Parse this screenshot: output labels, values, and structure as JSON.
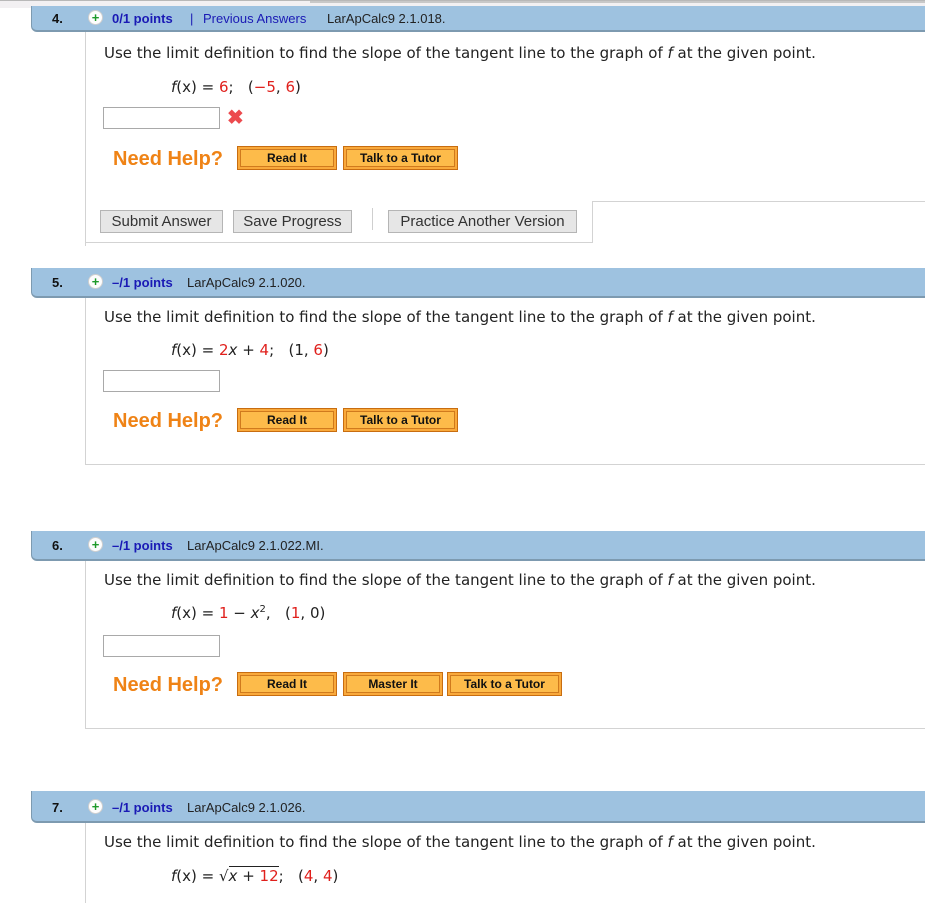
{
  "questions": [
    {
      "number": "4.",
      "points": "0/1 points",
      "separator": "|",
      "previous_answers": "Previous Answers",
      "code": "LarApCalc9 2.1.018.",
      "prompt_pre": "Use the limit definition to find the slope of the tangent line to the graph of ",
      "prompt_var": "f",
      "prompt_post": " at the given point.",
      "formula": {
        "fname": "f",
        "arg": "(x)",
        "eq": " = ",
        "expr_red": "6",
        "expr_tail": ";",
        "point_open": "(",
        "point_x": "−5",
        "point_comma": ", ",
        "point_y": "6",
        "point_close": ")"
      },
      "answer_value": "",
      "status": "incorrect",
      "help_label": "Need Help?",
      "help_buttons": [
        "Read It",
        "Talk to a Tutor"
      ],
      "actions": {
        "submit": "Submit Answer",
        "save": "Save Progress",
        "practice": "Practice Another Version"
      }
    },
    {
      "number": "5.",
      "points": "–/1 points",
      "code": "LarApCalc9 2.1.020.",
      "prompt_pre": "Use the limit definition to find the slope of the tangent line to the graph of ",
      "prompt_var": "f",
      "prompt_post": " at the given point.",
      "formula": {
        "fname": "f",
        "arg": "(x)",
        "eq": " = ",
        "a": "2",
        "x": "x",
        "plus": " + ",
        "b": "4",
        "tail": ";",
        "point_open": "(",
        "point_x": "1",
        "point_comma": ", ",
        "point_y": "6",
        "point_close": ")"
      },
      "answer_value": "",
      "help_label": "Need Help?",
      "help_buttons": [
        "Read It",
        "Talk to a Tutor"
      ]
    },
    {
      "number": "6.",
      "points": "–/1 points",
      "code": "LarApCalc9 2.1.022.MI.",
      "prompt_pre": "Use the limit definition to find the slope of the tangent line to the graph of ",
      "prompt_var": "f",
      "prompt_post": " at the given point.",
      "formula": {
        "fname": "f",
        "arg": "(x)",
        "eq": " = ",
        "a": "1",
        "minus": " − ",
        "x": "x",
        "exp": "2",
        "tail": ",",
        "point_open": "(",
        "point_x": "1",
        "point_comma": ", ",
        "point_y": "0",
        "point_close": ")"
      },
      "answer_value": "",
      "help_label": "Need Help?",
      "help_buttons": [
        "Read It",
        "Master It",
        "Talk to a Tutor"
      ]
    },
    {
      "number": "7.",
      "points": "–/1 points",
      "code": "LarApCalc9 2.1.026.",
      "prompt_pre": "Use the limit definition to find the slope of the tangent line to the graph of ",
      "prompt_var": "f",
      "prompt_post": " at the given point.",
      "formula": {
        "fname": "f",
        "arg": "(x)",
        "eq": " = ",
        "radical": "√",
        "x": "x",
        "plus": " + ",
        "b": "12",
        "tail": ";",
        "point_open": "(",
        "point_x": "4",
        "point_comma": ", ",
        "point_y": "4",
        "point_close": ")"
      }
    }
  ],
  "icons": {
    "plus": "+",
    "incorrect": "✖"
  }
}
